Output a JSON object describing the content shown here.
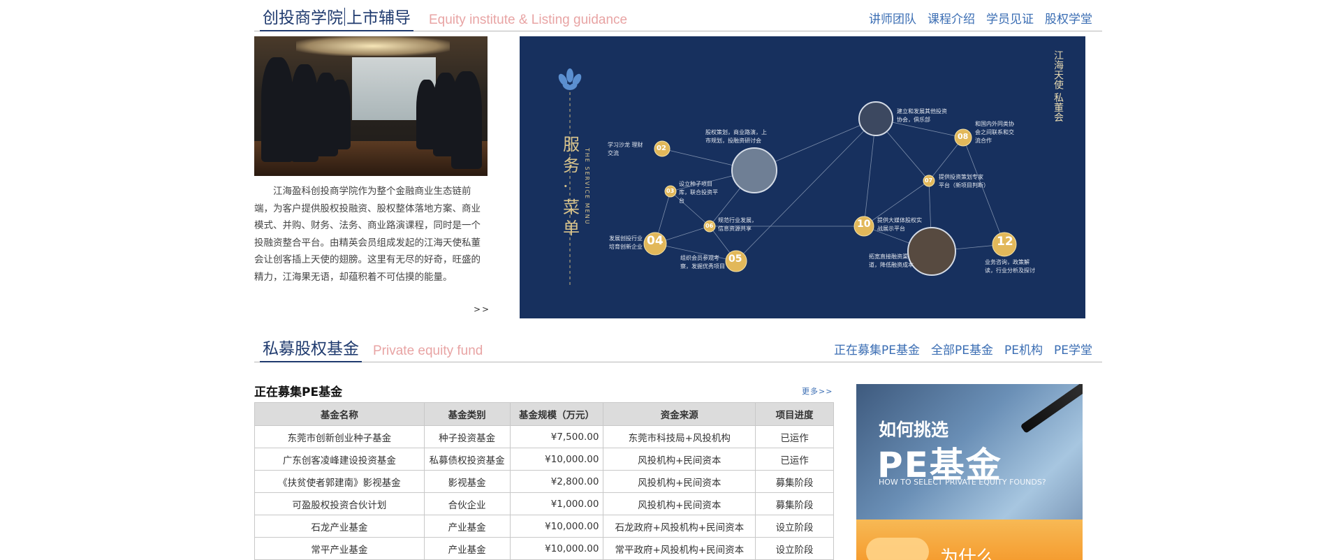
{
  "section1": {
    "title_a": "创投商学院",
    "title_b": "上市辅导",
    "subtitle": "Equity institute & Listing guidance",
    "nav": [
      "讲师团队",
      "课程介绍",
      "学员见证",
      "股权学堂"
    ]
  },
  "intro": {
    "text": "江海盈科创投商学院作为整个金融商业生态链前端，为客户提供股权投融资、股权整体落地方案、商业模式、并购、财务、法务、商业路演课程，同时是一个投融资整合平台。由精英会员组成发起的江海天使私董会让创客插上天使的翅膀。这里有无尽的好奇，旺盛的精力，江海果无语，却蕴积着不可估摸的能量。",
    "more": ">>"
  },
  "service_menu": {
    "title": "服务·菜单",
    "title_en": "THE SERVICE MENU",
    "brand": "江海天使 私董会",
    "nodes": [
      {
        "num": "02",
        "label": "学习沙龙 理财交流"
      },
      {
        "num": "03",
        "label": "设立种子项目库，联合投资平台"
      },
      {
        "num": "04",
        "label": "发展创投行业 培育创新企业"
      },
      {
        "num": "05",
        "label": "组织会员参观考察，发掘优秀项目"
      },
      {
        "num": "06",
        "label": "规范行业发展，信息资源共享"
      },
      {
        "num": "07",
        "label": "提供投资策划专家平台（新项目判断）"
      },
      {
        "num": "08",
        "label": "和国内外同类协会之间联系和交流合作"
      },
      {
        "num": "10",
        "label": "提供大媒体股权实战展示平台"
      },
      {
        "num": "12",
        "label": "业务咨询，政策解读，行业分析及探讨"
      },
      {
        "num": "",
        "label": "股权策划，商业路演，上市规划，投融资研讨会"
      },
      {
        "num": "",
        "label": "建立和发展其他投资协会，俱乐部"
      },
      {
        "num": "",
        "label": "拓宽直接融资渠道，降低融资成本"
      }
    ]
  },
  "section2": {
    "title": "私募股权基金",
    "subtitle": "Private equity fund",
    "nav": [
      "正在募集PE基金",
      "全部PE基金",
      "PE机构",
      "PE学堂"
    ]
  },
  "pe_table": {
    "caption": "正在募集PE基金",
    "more": "更多>>",
    "headers": [
      "基金名称",
      "基金类别",
      "基金规模（万元）",
      "资金来源",
      "项目进度"
    ],
    "rows": [
      [
        "东莞市创新创业种子基金",
        "种子投资基金",
        "¥7,500.00",
        "东莞市科技局+风投机构",
        "已运作"
      ],
      [
        "广东创客凌峰建设投资基金",
        "私募债权投资基金",
        "¥10,000.00",
        "风投机构+民间资本",
        "已运作"
      ],
      [
        "《扶贫使者郭建南》影视基金",
        "影视基金",
        "¥2,800.00",
        "风投机构+民间资本",
        "募集阶段"
      ],
      [
        "可盈股权投资合伙计划",
        "合伙企业",
        "¥1,000.00",
        "风投机构+民间资本",
        "募集阶段"
      ],
      [
        "石龙产业基金",
        "产业基金",
        "¥10,000.00",
        "石龙政府+风投机构+民间资本",
        "设立阶段"
      ],
      [
        "常平产业基金",
        "产业基金",
        "¥10,000.00",
        "常平政府+风投机构+民间资本",
        "设立阶段"
      ]
    ]
  },
  "banner": {
    "line1": "如何挑选",
    "line2": "PE基金",
    "line3": "HOW TO SELECT PRIVATE EQUITY FOUNDS?",
    "line4": "为什么"
  }
}
